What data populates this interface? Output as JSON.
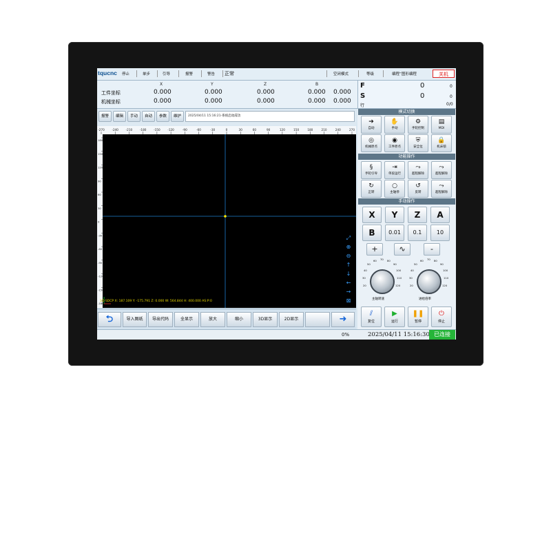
{
  "topbar": {
    "brand": "tqucnc",
    "items": [
      "停止",
      "单步",
      "引导",
      "报警",
      "警告"
    ],
    "status_text": "正常",
    "right_items": [
      "空闭模式",
      "等级",
      "编程”图形编程"
    ],
    "shutdown": "关机"
  },
  "coords": {
    "headers": [
      "X",
      "Y",
      "Z",
      "B",
      "C"
    ],
    "row1_label": "工件坐标",
    "row2_label": "机械坐标",
    "row1": [
      "0.000",
      "0.000",
      "0.000",
      "0.000",
      "0.000"
    ],
    "row2": [
      "0.000",
      "0.000",
      "0.000",
      "0.000",
      "0.000"
    ]
  },
  "fs": {
    "f_label": "F",
    "f_val": "0",
    "f_small": "0",
    "s_label": "S",
    "s_val": "0",
    "s_small": "0",
    "row_label": "行",
    "row_val": "0/0"
  },
  "subtool": {
    "buttons": [
      "报警",
      "编辑",
      "手动",
      "自动",
      "参数",
      "维护"
    ],
    "message": "2025/04/11 15:16:21-系统启动成功"
  },
  "plot": {
    "x_ticks": [
      "-270",
      "-240",
      "-210",
      "-180",
      "-150",
      "-120",
      "-90",
      "-60",
      "-30",
      "0",
      "30",
      "60",
      "90",
      "120",
      "150",
      "180",
      "210",
      "240",
      "270"
    ],
    "y_ticks": [
      "180",
      "150",
      "120",
      "90",
      "60",
      "30",
      "0",
      "-30",
      "-60",
      "-90",
      "-120",
      "-150",
      "-180"
    ],
    "status_line": "2D-SDCP X: 187.109 Y: -175.791 Z: 0.000 W: 564.844 H: 400.000 AS:P:0"
  },
  "btoolbar": {
    "buttons": [
      "导入图纸",
      "导出代码",
      "全显示",
      "放大",
      "缩小",
      "3D显示",
      "2D显示"
    ]
  },
  "bottom": {
    "percent": "0%",
    "datetime": "2025/04/11 15:16:30",
    "connection": "已连接"
  },
  "rpanel": {
    "mode_title": "模式切换",
    "mode_buttons": [
      {
        "label": "自动",
        "icon": "arrow-right-icon"
      },
      {
        "label": "手动",
        "icon": "hand-icon"
      },
      {
        "label": "手轮控制",
        "icon": "wheel-icon"
      },
      {
        "label": "MDI",
        "icon": "mdi-icon"
      },
      {
        "label": "机械原点",
        "icon": "origin-icon"
      },
      {
        "label": "工件原点",
        "icon": "work-origin-icon"
      },
      {
        "label": "安全位",
        "icon": "safe-icon"
      },
      {
        "label": "机床锁",
        "icon": "lock-icon"
      }
    ],
    "func_title": "功能操作",
    "func_buttons": [
      {
        "label": "手轮引导",
        "icon": "guide-icon"
      },
      {
        "label": "单段运行",
        "icon": "single-icon"
      },
      {
        "label": "超程解除",
        "icon": "overtravel-icon"
      },
      {
        "label": "超程解除",
        "icon": "overtravel-icon"
      },
      {
        "label": "正转",
        "icon": "cw-icon"
      },
      {
        "label": "主轴停",
        "icon": "spindle-stop-icon"
      },
      {
        "label": "反转",
        "icon": "ccw-icon"
      },
      {
        "label": "超程解除",
        "icon": "overtravel-icon"
      }
    ],
    "manual_title": "手动操作",
    "axis_buttons": [
      "X",
      "Y",
      "Z",
      "A",
      "B",
      "0.01",
      "0.1",
      "10"
    ],
    "plus": "+",
    "minus": "-",
    "wave": "∿",
    "dial1_label": "主轴转速",
    "dial2_label": "进给倍率",
    "dial_ticks": [
      "50",
      "60",
      "70",
      "80",
      "90",
      "100",
      "110",
      "120",
      "40",
      "30",
      "20",
      "10"
    ],
    "ctrl_buttons": [
      {
        "label": "复位",
        "icon": "reset-icon",
        "color": "#1a5fd0"
      },
      {
        "label": "运行",
        "icon": "run-icon",
        "color": "#1fb030"
      },
      {
        "label": "暂停",
        "icon": "pause-icon",
        "color": "#f0a000"
      },
      {
        "label": "停止",
        "icon": "stop-icon",
        "color": "#e02020"
      }
    ]
  }
}
